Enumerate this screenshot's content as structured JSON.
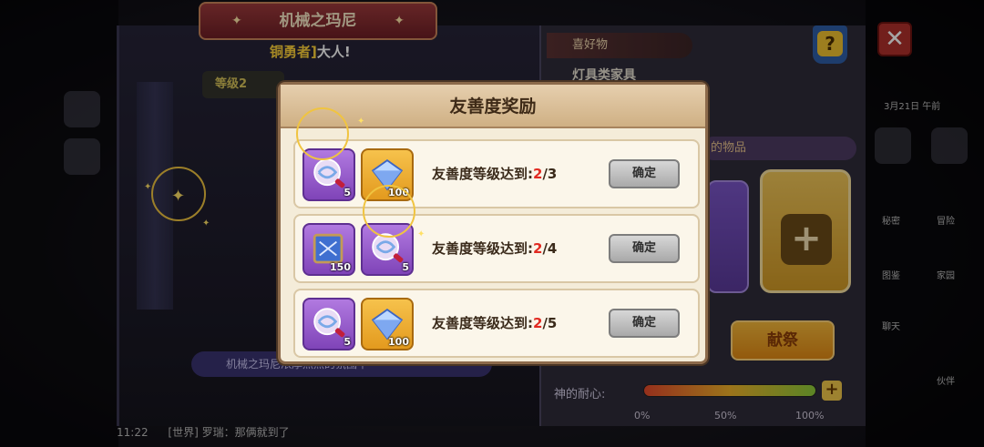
{
  "npc_title": "机械之玛尼",
  "greeting": {
    "highlight": "铜勇者]",
    "rest": "大人!"
  },
  "level_chip": "等级2",
  "hint_bar": "机械之玛尼浓厚热烈的氛围中",
  "chat": {
    "time": "11:22",
    "text": "[世界] 罗瑞：那俩就到了"
  },
  "info_panel": {
    "tab_label": "喜好物",
    "category": "灯具类家具",
    "items_tab": "的物品",
    "offer_button": "献祭",
    "patience_label": "神的耐心:",
    "patience_ticks": [
      "0%",
      "50%",
      "100%"
    ]
  },
  "right_rail": {
    "date_label": "3月21日 午前",
    "labels": [
      "秘密",
      "冒险",
      "图鉴",
      "家园",
      "聊天",
      "伙伴"
    ]
  },
  "modal": {
    "title": "友善度奖励",
    "rows": [
      {
        "rewards": [
          {
            "icon": "candy-icon",
            "count": "5"
          },
          {
            "icon": "diamond-icon",
            "count": "100"
          }
        ],
        "req_prefix": "友善度等级达到:",
        "req_current": "2",
        "req_target": "/3",
        "button": "确定"
      },
      {
        "rewards": [
          {
            "icon": "map-scroll-icon",
            "count": "150"
          },
          {
            "icon": "candy-icon",
            "count": "5"
          }
        ],
        "req_prefix": "友善度等级达到:",
        "req_current": "2",
        "req_target": "/4",
        "button": "确定"
      },
      {
        "rewards": [
          {
            "icon": "candy-icon",
            "count": "5"
          },
          {
            "icon": "diamond-icon",
            "count": "100"
          }
        ],
        "req_prefix": "友善度等级达到:",
        "req_current": "2",
        "req_target": "/5",
        "button": "确定"
      }
    ]
  },
  "colors": {
    "modal_bg": "#f4ecd9",
    "req_highlight": "#e12b22",
    "close": "#b0312b",
    "offer": "#f5b83a"
  }
}
